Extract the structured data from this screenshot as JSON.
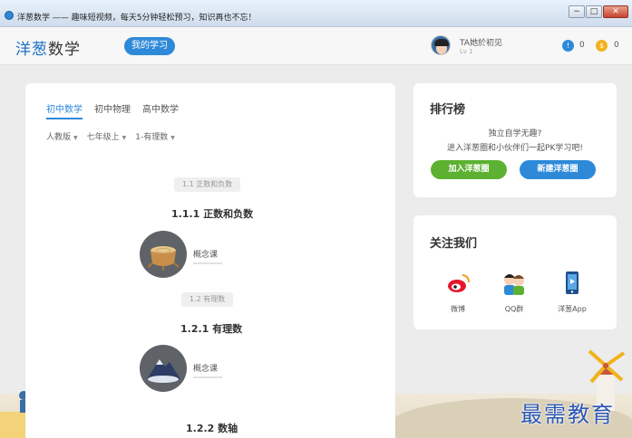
{
  "window": {
    "title": "洋葱数学 —— 趣味短视频，每天5分钟轻松预习，知识再也不忘！",
    "buttons": [
      "−",
      "□",
      "✕"
    ]
  },
  "header": {
    "logo_brand": "洋葱",
    "logo_word": "数学",
    "my_learning": "我的学习",
    "user_name": "TA她於初见",
    "user_level": "Lv 1",
    "coin_blue_icon": "!",
    "coin_blue_value": "0",
    "coin_gold_icon": "$",
    "coin_gold_value": "0"
  },
  "subjects": {
    "tabs": [
      {
        "label": "初中数学",
        "active": true
      },
      {
        "label": "初中物理",
        "active": false
      },
      {
        "label": "高中数学",
        "active": false
      }
    ],
    "filters": [
      "人教版",
      "七年级上",
      "1-有理数"
    ]
  },
  "sections": [
    {
      "badge": "1.1 正数和负数",
      "title": "1.1.1 正数和负数",
      "lesson": "概念课",
      "icon": "tree-stump-icon"
    },
    {
      "badge": "1.2 有理数",
      "title": "1.2.1 有理数",
      "lesson": "概念课",
      "icon": "mountain-icon"
    },
    {
      "title": "1.2.2 数轴"
    }
  ],
  "ranking": {
    "title": "排行榜",
    "line1": "独立自学无趣?",
    "line2": "进入洋葱圈和小伙伴们一起PK学习吧!",
    "join_button": "加入洋葱圈",
    "create_button": "新建洋葱圈",
    "colors": {
      "join": "#5cb130",
      "create": "#2e8ad9"
    }
  },
  "follow": {
    "title": "关注我们",
    "items": [
      {
        "label": "微博",
        "icon": "weibo-icon"
      },
      {
        "label": "QQ群",
        "icon": "qq-group-icon"
      },
      {
        "label": "洋葱App",
        "icon": "phone-app-icon"
      }
    ]
  },
  "watermark": "最需教育",
  "accent": "#2e8ad9"
}
